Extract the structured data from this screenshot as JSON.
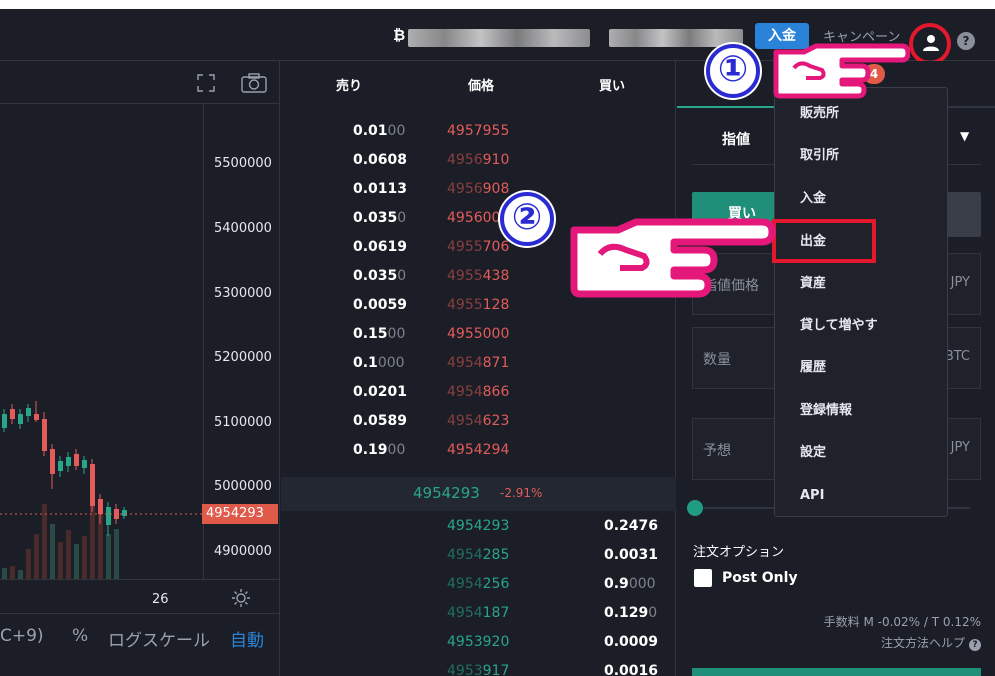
{
  "header": {
    "btc_symbol": "₿",
    "deposit_label": "入金",
    "campaign_label": "キャンペーン",
    "help_label": "?"
  },
  "chart": {
    "price_axis": [
      "5500000",
      "5400000",
      "5300000",
      "5200000",
      "5100000",
      "5000000",
      "4900000"
    ],
    "last_price": "4954293",
    "time_label": "26",
    "timezone_label": "C+9)",
    "percent_label": "%",
    "logscale_label": "ログスケール",
    "auto_label": "自動"
  },
  "orderbook": {
    "col_sell": "売り",
    "col_price": "価格",
    "col_buy": "買い",
    "asks": [
      {
        "size_main": "0.01",
        "size_dim": "00",
        "price_main": "4957955",
        "price_dim": ""
      },
      {
        "size_main": "0.0608",
        "size_dim": "",
        "price_main": "910",
        "price_dim": "4956"
      },
      {
        "size_main": "0.0113",
        "size_dim": "",
        "price_main": "908",
        "price_dim": "4956"
      },
      {
        "size_main": "0.035",
        "size_dim": "0",
        "price_main": "4956007",
        "price_dim": ""
      },
      {
        "size_main": "0.0619",
        "size_dim": "",
        "price_main": "706",
        "price_dim": "4955"
      },
      {
        "size_main": "0.035",
        "size_dim": "0",
        "price_main": "438",
        "price_dim": "4955"
      },
      {
        "size_main": "0.0059",
        "size_dim": "",
        "price_main": "128",
        "price_dim": "4955"
      },
      {
        "size_main": "0.15",
        "size_dim": "00",
        "price_main": "4955000",
        "price_dim": ""
      },
      {
        "size_main": "0.1",
        "size_dim": "000",
        "price_main": "871",
        "price_dim": "4954"
      },
      {
        "size_main": "0.0201",
        "size_dim": "",
        "price_main": "866",
        "price_dim": "4954"
      },
      {
        "size_main": "0.0589",
        "size_dim": "",
        "price_main": "623",
        "price_dim": "4954"
      },
      {
        "size_main": "0.19",
        "size_dim": "00",
        "price_main": "4954294",
        "price_dim": ""
      }
    ],
    "mid_price": "4954293",
    "mid_change": "-2.91%",
    "bids": [
      {
        "price_main": "4954293",
        "price_dim": "",
        "size_main": "0.2476",
        "size_dim": ""
      },
      {
        "price_main": "285",
        "price_dim": "4954",
        "size_main": "0.0031",
        "size_dim": ""
      },
      {
        "price_main": "256",
        "price_dim": "4954",
        "size_main": "0.9",
        "size_dim": "000"
      },
      {
        "price_main": "187",
        "price_dim": "4954",
        "size_main": "0.129",
        "size_dim": "0"
      },
      {
        "price_main": "4953920",
        "price_dim": "",
        "size_main": "0.0009",
        "size_dim": ""
      },
      {
        "price_main": "917",
        "price_dim": "4953",
        "size_main": "0.0016",
        "size_dim": ""
      }
    ]
  },
  "order_panel": {
    "tab_limit": "指値",
    "buy_label": "買い",
    "field_price": "指値価格",
    "field_price_unit": "JPY",
    "field_qty": "数量",
    "field_qty_unit": "BTC",
    "field_est": "予想",
    "field_est_unit": "JPY",
    "options_title": "注文オプション",
    "post_only": "Post Only",
    "fee": "手数料 M -0.02% / T 0.12%",
    "order_help": "注文方法ヘルプ"
  },
  "menu": {
    "badge": "4",
    "items": [
      "販売所",
      "取引所",
      "入金",
      "出金",
      "資産",
      "貸して増やす",
      "履歴",
      "登録情報",
      "設定",
      "API"
    ]
  },
  "annotations": {
    "step1": "①",
    "step2": "②"
  },
  "colors": {
    "background": "#1b1e26",
    "accent_blue": "#2a83d9",
    "sell_red": "#e35b5b",
    "buy_green": "#29a58a",
    "highlight_red": "#e3182c"
  }
}
